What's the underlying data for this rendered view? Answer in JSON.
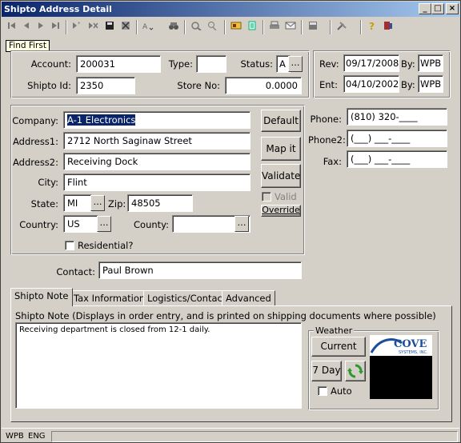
{
  "window": {
    "title": "Shipto Address Detail"
  },
  "titlebar_buttons": {
    "minimize": "_",
    "maximize": "□",
    "close": "×"
  },
  "tooltip": "Find First",
  "toolbar_icons": [
    "first-record-icon",
    "prev-record-icon",
    "next-record-icon",
    "last-record-icon",
    "new-record-icon",
    "delete-record-icon",
    "save-icon",
    "clear-icon",
    "sort-icon",
    "find-icon",
    "binoculars-icon",
    "search-icon",
    "card-icon",
    "document-icon",
    "print-icon",
    "email-icon",
    "calculator-icon",
    "tools-icon",
    "help-icon",
    "exit-icon"
  ],
  "header": {
    "account_label": "Account:",
    "account_value": "200031",
    "type_label": "Type:",
    "type_value": "",
    "status_label": "Status:",
    "status_value": "A",
    "shiptoid_label": "Shipto Id:",
    "shiptoid_value": "2350",
    "storeno_label": "Store No:",
    "storeno_value": "0.0000",
    "rev_label": "Rev:",
    "rev_value": "09/17/2008",
    "rev_by_label": "By:",
    "rev_by_value": "WPB",
    "ent_label": "Ent:",
    "ent_value": "04/10/2002",
    "ent_by_label": "By:",
    "ent_by_value": "WPB"
  },
  "address": {
    "company_label": "Company:",
    "company_value": "A-1 Electronics",
    "address1_label": "Address1:",
    "address1_value": "2712 North Saginaw Street",
    "address2_label": "Address2:",
    "address2_value": "Receiving Dock",
    "city_label": "City:",
    "city_value": "Flint",
    "state_label": "State:",
    "state_value": "MI",
    "zip_label": "Zip:",
    "zip_value": "48505",
    "country_label": "Country:",
    "country_value": "US",
    "county_label": "County:",
    "county_value": "",
    "residential_label": "Residential?",
    "default_button": "Default",
    "mapit_button": "Map it",
    "validate_button": "Validate",
    "valid_label": "Valid",
    "override_button": "Override"
  },
  "phones": {
    "phone_label": "Phone:",
    "phone_value": "(810) 320-____",
    "phone2_label": "Phone2:",
    "phone2_value": "(___) ___-____",
    "fax_label": "Fax:",
    "fax_value": "(___) ___-____"
  },
  "contact": {
    "label": "Contact:",
    "value": "Paul Brown"
  },
  "tabs": [
    {
      "label": "Shipto Note",
      "active": true
    },
    {
      "label": "Tax Information",
      "active": false
    },
    {
      "label": "Logistics/Contact",
      "active": false
    },
    {
      "label": "Advanced",
      "active": false
    }
  ],
  "note": {
    "heading": "Shipto Note (Displays in order entry, and is printed on shipping documents where possible)",
    "text": "Receiving department is closed from 12-1 daily."
  },
  "weather": {
    "group_label": "Weather",
    "current_button": "Current",
    "sevenday_button": "7 Day",
    "auto_label": "Auto",
    "logo_text": "COVE",
    "logo_subtext": "SYSTEMS, INC."
  },
  "statusbar": {
    "user": "WPB",
    "lang": "ENG"
  },
  "colors": {
    "titlebar_start": "#0a246a",
    "titlebar_end": "#a6caf0",
    "face": "#d4d0c8",
    "selection": "#0a246a",
    "weather_panel": "#000000",
    "logo_blue": "#1a4e9c"
  }
}
